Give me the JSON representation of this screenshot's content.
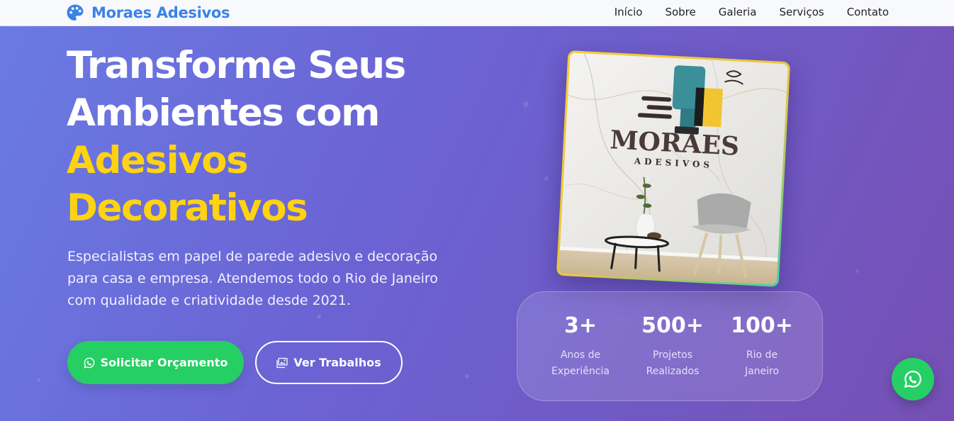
{
  "brand": {
    "name": "Moraes Adesivos",
    "icon": "palette-icon",
    "color": "#3b82e6"
  },
  "nav": {
    "items": [
      {
        "label": "Início"
      },
      {
        "label": "Sobre"
      },
      {
        "label": "Galeria"
      },
      {
        "label": "Serviços"
      },
      {
        "label": "Contato"
      }
    ]
  },
  "hero": {
    "title_line1": "Transforme Seus",
    "title_line2": "Ambientes com",
    "title_accent1": "Adesivos",
    "title_accent2": "Decorativos",
    "subtitle": "Especialistas em papel de parede adesivo e decoração para casa e empresa. Atendemos todo o Rio de Janeiro com qualidade e criatividade desde 2021.",
    "primary_button": {
      "label": "Solicitar Orçamento",
      "icon": "whatsapp-icon"
    },
    "secondary_button": {
      "label": "Ver Trabalhos",
      "icon": "images-icon"
    },
    "image": {
      "logo_text": "MORAES",
      "logo_subtext": "ADESIVOS"
    }
  },
  "stats": [
    {
      "value": "3+",
      "label_line1": "Anos de",
      "label_line2": "Experiência"
    },
    {
      "value": "500+",
      "label_line1": "Projetos",
      "label_line2": "Realizados"
    },
    {
      "value": "100+",
      "label_line1": "Rio de",
      "label_line2": "Janeiro"
    }
  ],
  "whatsapp_float": {
    "icon": "whatsapp-icon"
  },
  "colors": {
    "accent": "#ffd311",
    "whatsapp_green": "#25cf63",
    "hero_gradient_start": "#6a7be3",
    "hero_gradient_end": "#7650b4"
  }
}
